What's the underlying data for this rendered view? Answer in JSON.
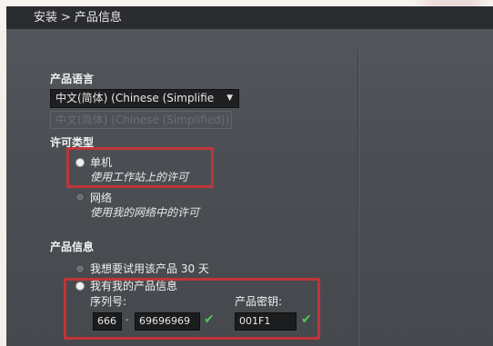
{
  "breadcrumb": {
    "step": "安装",
    "separator": ">",
    "page": "产品信息"
  },
  "language": {
    "label": "产品语言",
    "selected": "中文(简体) (Chinese (Simplifie",
    "secondary": "中文(简体) (Chinese (Simplified))"
  },
  "license": {
    "label": "许可类型",
    "options": [
      {
        "title": "单机",
        "description": "使用工作站上的许可",
        "selected": true
      },
      {
        "title": "网络",
        "description": "使用我的网络中的许可",
        "selected": false
      }
    ]
  },
  "product_info": {
    "label": "产品信息",
    "options": [
      {
        "title": "我想要试用该产品 30 天",
        "selected": false
      },
      {
        "title": "我有我的产品信息",
        "selected": true
      }
    ],
    "serial_label": "序列号:",
    "serial_prefix": "666",
    "serial_separator": "-",
    "serial_number": "69696969",
    "key_label": "产品密钥:",
    "product_key": "001F1"
  },
  "colors": {
    "highlight": "#c0343a",
    "valid_check": "#53c653",
    "panel": "#4b4f54"
  }
}
